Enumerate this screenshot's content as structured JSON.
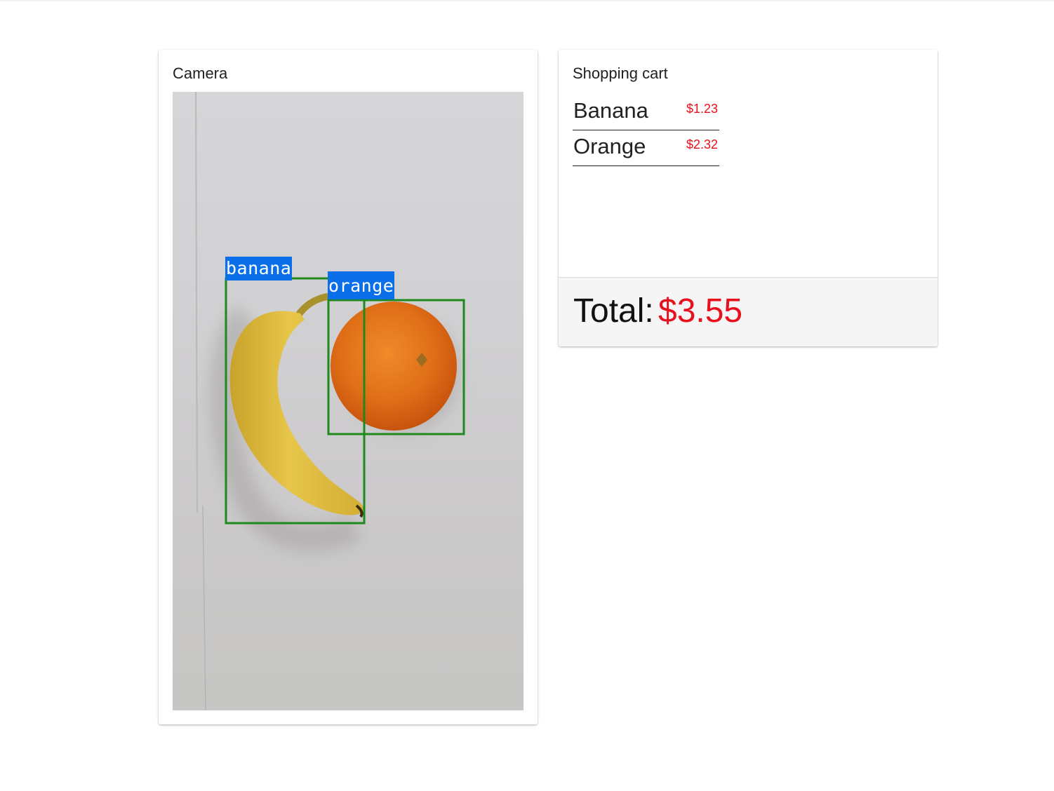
{
  "camera": {
    "title": "Camera",
    "detections": [
      {
        "label": "banana",
        "box_color": "#1e8a1e",
        "label_bg": "#0a6fe8"
      },
      {
        "label": "orange",
        "box_color": "#1e8a1e",
        "label_bg": "#0a6fe8"
      }
    ]
  },
  "cart": {
    "title": "Shopping cart",
    "items": [
      {
        "name": "Banana",
        "price": "$1.23"
      },
      {
        "name": "Orange",
        "price": "$2.32"
      }
    ],
    "total_label": "Total:",
    "total_value": "$3.55"
  },
  "colors": {
    "price": "#e8101c",
    "detection_box": "#1e8a1e",
    "detection_label": "#0a6fe8",
    "footer_bg": "#f5f5f5"
  }
}
